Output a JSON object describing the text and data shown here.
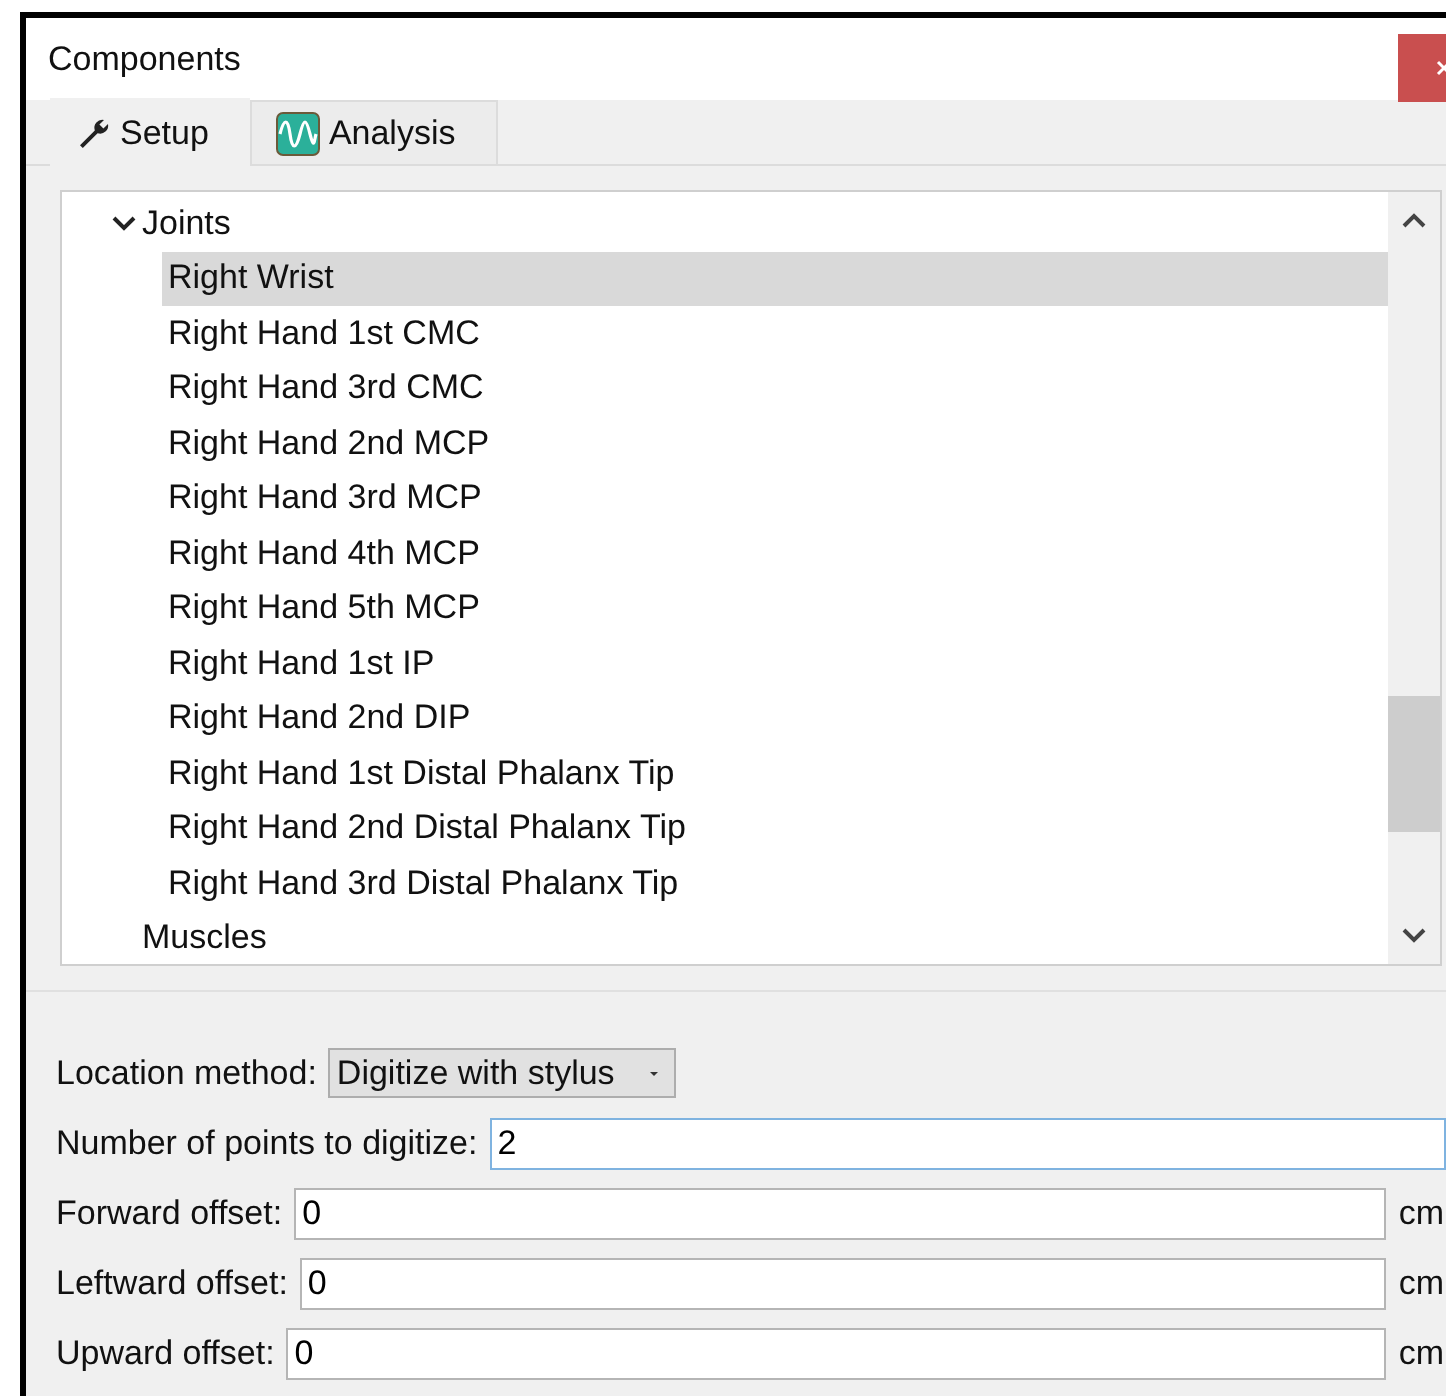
{
  "window": {
    "title": "Components"
  },
  "tabs": [
    {
      "label": "Setup",
      "selected": true
    },
    {
      "label": "Analysis",
      "selected": false
    }
  ],
  "tree": [
    {
      "label": "Joints",
      "expanded": true,
      "children": [
        {
          "label": "Right Wrist",
          "selected": true
        },
        {
          "label": "Right Hand 1st CMC",
          "selected": false
        },
        {
          "label": "Right Hand 3rd CMC",
          "selected": false
        },
        {
          "label": "Right Hand 2nd MCP",
          "selected": false
        },
        {
          "label": "Right Hand 3rd MCP",
          "selected": false
        },
        {
          "label": "Right Hand 4th MCP",
          "selected": false
        },
        {
          "label": "Right Hand 5th MCP",
          "selected": false
        },
        {
          "label": "Right Hand 1st IP",
          "selected": false
        },
        {
          "label": "Right Hand 2nd DIP",
          "selected": false
        },
        {
          "label": "Right Hand 1st Distal Phalanx Tip",
          "selected": false
        },
        {
          "label": "Right Hand 2nd Distal Phalanx Tip",
          "selected": false
        },
        {
          "label": "Right Hand 3rd Distal Phalanx Tip",
          "selected": false
        }
      ]
    },
    {
      "label": "Muscles",
      "expanded": false
    }
  ],
  "form": [
    {
      "kind": "dropdown",
      "label": "Location method:",
      "value": "Digitize with stylus"
    },
    {
      "kind": "field",
      "label": "Number of points to digitize:",
      "value": "2",
      "focused": true
    },
    {
      "kind": "field",
      "label": "Forward offset:",
      "value": "0",
      "unit": "cm",
      "focused": false
    },
    {
      "kind": "field",
      "label": "Leftward offset:",
      "value": "0",
      "unit": "cm",
      "focused": false
    },
    {
      "kind": "field",
      "label": "Upward offset:",
      "value": "0",
      "unit": "cm",
      "focused": false
    }
  ]
}
